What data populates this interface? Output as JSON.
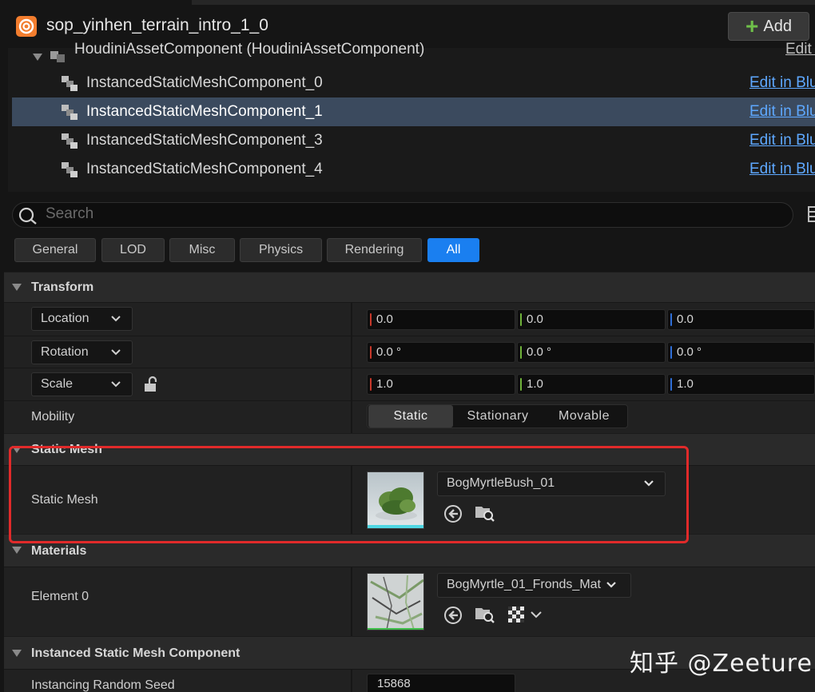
{
  "header": {
    "title": "sop_yinhen_terrain_intro_1_0",
    "add_label": "Add"
  },
  "tree": {
    "root": {
      "label": "HoudiniAssetComponent (HoudiniAssetComponent)",
      "edit": "Edit i"
    },
    "items": [
      {
        "label": "InstancedStaticMeshComponent_0",
        "edit": "Edit in Blu",
        "selected": false
      },
      {
        "label": "InstancedStaticMeshComponent_1",
        "edit": "Edit in Blu",
        "selected": true
      },
      {
        "label": "InstancedStaticMeshComponent_3",
        "edit": "Edit in Blu",
        "selected": false
      },
      {
        "label": "InstancedStaticMeshComponent_4",
        "edit": "Edit in Blu",
        "selected": false
      }
    ]
  },
  "search": {
    "placeholder": "Search"
  },
  "tabs": [
    "General",
    "LOD",
    "Misc",
    "Physics",
    "Rendering",
    "All"
  ],
  "active_tab": "All",
  "transform": {
    "title": "Transform",
    "location": {
      "label": "Location",
      "x": "0.0",
      "y": "0.0",
      "z": "0.0"
    },
    "rotation": {
      "label": "Rotation",
      "x": "0.0 °",
      "y": "0.0 °",
      "z": "0.0 °"
    },
    "scale": {
      "label": "Scale",
      "x": "1.0",
      "y": "1.0",
      "z": "1.0"
    },
    "mobility": {
      "label": "Mobility",
      "options": [
        "Static",
        "Stationary",
        "Movable"
      ],
      "selected": "Static"
    }
  },
  "static_mesh": {
    "title": "Static Mesh",
    "label": "Static Mesh",
    "value": "BogMyrtleBush_01"
  },
  "materials": {
    "title": "Materials",
    "label": "Element 0",
    "value": "BogMyrtle_01_Fronds_Mat"
  },
  "instanced": {
    "title": "Instanced Static Mesh Component",
    "seed_label": "Instancing Random Seed",
    "seed_value": "15868"
  },
  "watermark": "知乎 @Zeeture",
  "colors": {
    "accent": "#1a7ff0",
    "link": "#5ea8ff",
    "highlight": "#e12a2a",
    "axis_x": "#c8382a",
    "axis_y": "#6fb33a",
    "axis_z": "#2f6fd8"
  }
}
